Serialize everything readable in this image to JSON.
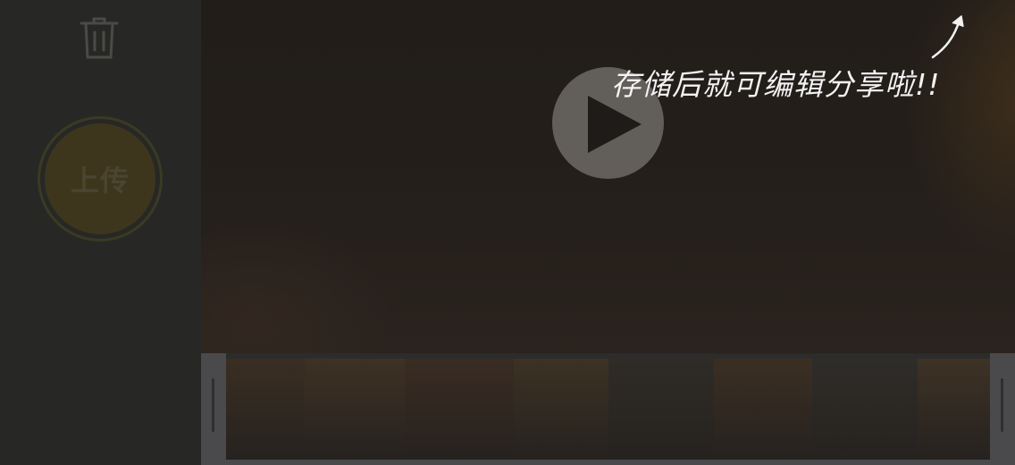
{
  "side_panel": {
    "delete_icon": "trash-icon",
    "upload_label": "上传"
  },
  "video": {
    "play_icon": "play-icon",
    "hint": "存储后就可编辑分享啦!!",
    "hint_arrow_icon": "arrow-up-right-icon"
  },
  "timeline": {
    "frame_count": 8,
    "frame_colors": [
      "#3a2e23",
      "#3e3124",
      "#3a2c22",
      "#3c3224",
      "#2f2b27",
      "#3b2f23",
      "#2f2d29",
      "#3d3225"
    ],
    "frame_widths": [
      88,
      112,
      122,
      106,
      118,
      110,
      118,
      81
    ]
  },
  "colors": {
    "panel_bg": "#272825",
    "upload_fill": "#3d361d",
    "play_button": "#787470",
    "timeline_handle": "#4a4a4c"
  }
}
